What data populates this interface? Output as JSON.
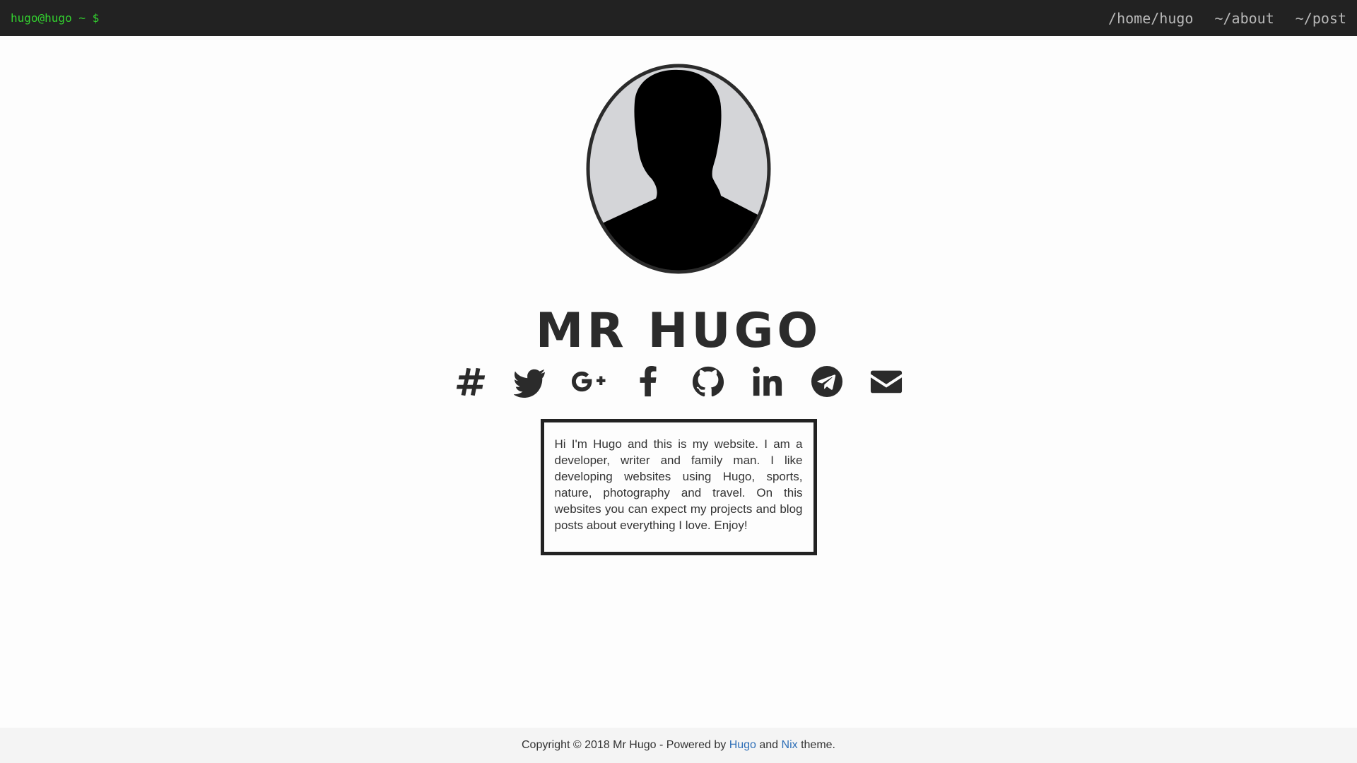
{
  "header": {
    "prompt": "hugo@hugo ~ $",
    "nav": [
      {
        "label": "/home/hugo"
      },
      {
        "label": "~/about"
      },
      {
        "label": "~/post"
      }
    ]
  },
  "profile": {
    "name": "MR HUGO",
    "socials": [
      {
        "icon": "hashtag-icon"
      },
      {
        "icon": "twitter-icon"
      },
      {
        "icon": "google-plus-icon"
      },
      {
        "icon": "facebook-icon"
      },
      {
        "icon": "github-icon"
      },
      {
        "icon": "linkedin-icon"
      },
      {
        "icon": "telegram-icon"
      },
      {
        "icon": "envelope-icon"
      }
    ],
    "bio": "Hi I'm Hugo and this is my website. I am a developer, writer and family man. I like developing websites using Hugo, sports, nature, photography and travel. On this websites you can expect my projects and blog posts about everything I love. Enjoy!"
  },
  "footer": {
    "prefix": "Copyright © 2018 Mr Hugo - Powered by ",
    "hugo_link": "Hugo",
    "and": " and ",
    "nix_link": "Nix",
    "suffix": " theme."
  },
  "colors": {
    "topbar": "#222222",
    "prompt": "#33d12f",
    "nav": "#b9b9b9",
    "link": "#2f6fb7"
  }
}
